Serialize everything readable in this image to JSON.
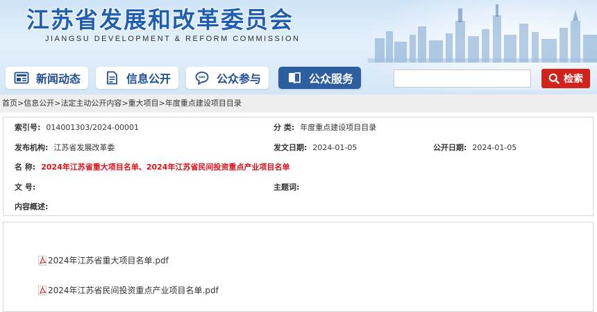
{
  "header": {
    "title": "江苏省发展和改革委员会",
    "subtitle": "JIANGSU DEVELOPMENT & REFORM COMMISSION"
  },
  "nav": [
    {
      "label": "新闻动态",
      "icon": "newspaper-icon",
      "active": false
    },
    {
      "label": "信息公开",
      "icon": "document-icon",
      "active": false
    },
    {
      "label": "公众参与",
      "icon": "chat-icon",
      "active": false
    },
    {
      "label": "公众服务",
      "icon": "book-icon",
      "active": true
    }
  ],
  "search": {
    "placeholder": "",
    "value": "",
    "button_label": "检索"
  },
  "breadcrumb": [
    "首页",
    "信息公开",
    "法定主动公开内容",
    "重大项目",
    "年度重点建设项目目录"
  ],
  "meta": {
    "index_no": {
      "label": "索引号:",
      "value": "014001303/2024-00001"
    },
    "category": {
      "label": "分 类:",
      "value": "年度重点建设项目目录"
    },
    "publisher": {
      "label": "发布机构:",
      "value": "江苏省发展改革委"
    },
    "doc_date": {
      "label": "发文日期:",
      "value": "2024-01-05"
    },
    "pub_date": {
      "label": "公开日期:",
      "value": "2024-01-05"
    },
    "name": {
      "label": "名 称:",
      "value": "2024年江苏省重大项目名单、2024年江苏省民间投资重点产业项目名单"
    },
    "doc_no": {
      "label": "文 号:",
      "value": ""
    },
    "subject": {
      "label": "主题词:",
      "value": ""
    },
    "summary": {
      "label": "内容概述:",
      "value": ""
    }
  },
  "attachments": [
    {
      "name": "2024年江苏省重大项目名单.pdf",
      "icon": "pdf-icon"
    },
    {
      "name": "2024年江苏省民间投资重点产业项目名单.pdf",
      "icon": "pdf-icon"
    }
  ],
  "colors": {
    "title_blue": "#1f5fb3",
    "nav_text": "#1d4e96",
    "nav_active_bg": "#2d5fa0",
    "search_button": "#d1221c",
    "highlight_red": "#e0101a"
  }
}
